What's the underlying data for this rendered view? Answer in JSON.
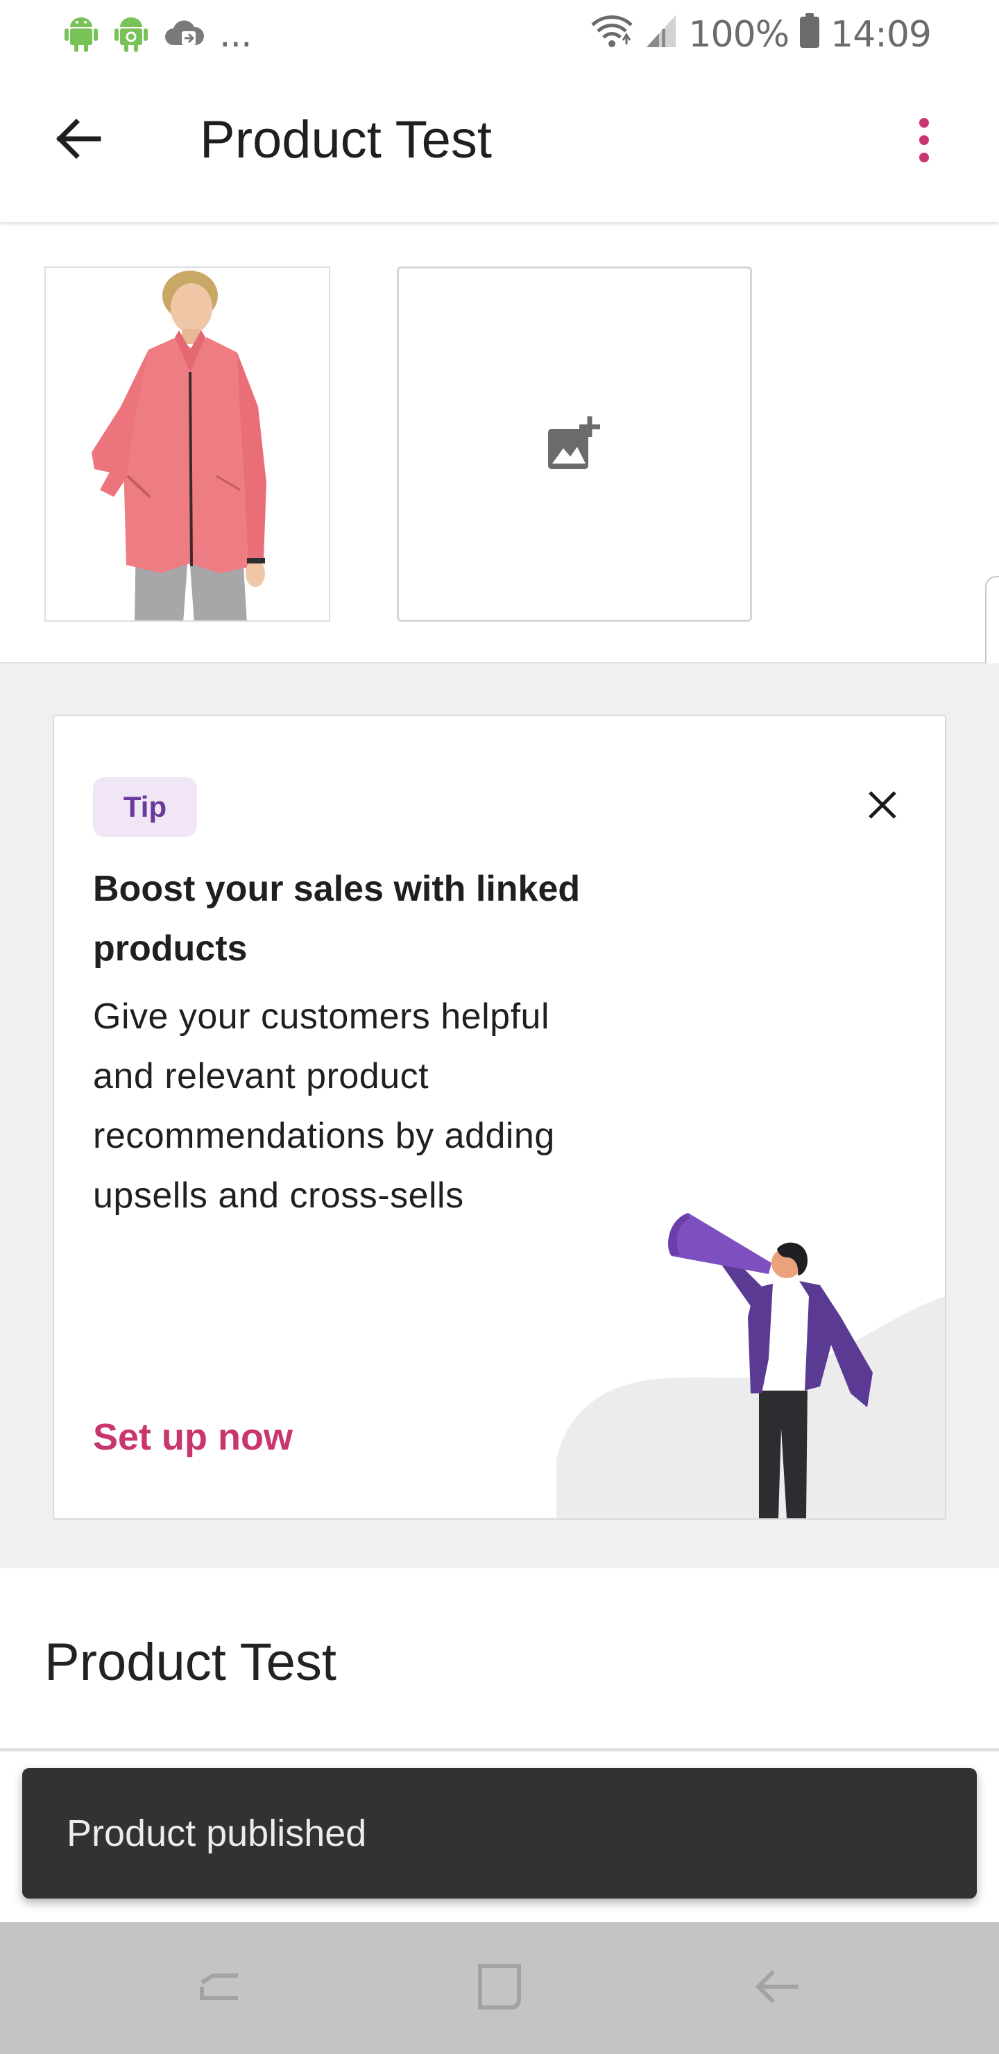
{
  "status_bar": {
    "battery": "100%",
    "time": "14:09",
    "overflow": "..."
  },
  "app_bar": {
    "title": "Product Test"
  },
  "tip_card": {
    "badge": "Tip",
    "title": "Boost your sales with linked products",
    "body": "Give your customers helpful and relevant product recommendations by adding upsells and cross-sells",
    "cta": "Set up now"
  },
  "product": {
    "name": "Product Test"
  },
  "snackbar": {
    "message": "Product published"
  },
  "colors": {
    "accent": "#c9356e",
    "badge_text": "#6a3a9a",
    "badge_bg": "#f1e6f6",
    "snackbar_bg": "#323232",
    "nav_bar_bg": "#c4c4c4"
  },
  "icons": {
    "status_left": [
      "android-icon",
      "android-icon",
      "cloud-sync-icon"
    ],
    "status_right": [
      "wifi-icon",
      "signal-icon",
      "battery-icon"
    ],
    "back": "arrow-back-icon",
    "more": "more-vert-icon",
    "add_image": "add-photo-icon",
    "close": "close-icon",
    "nav": [
      "recent-apps-icon",
      "home-icon",
      "back-nav-icon"
    ]
  }
}
